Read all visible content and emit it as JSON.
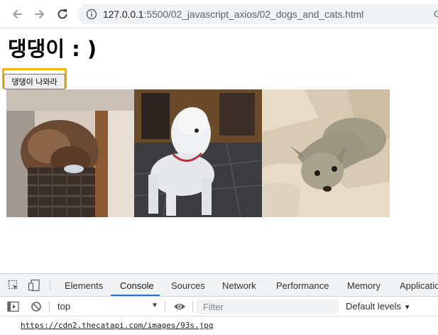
{
  "browser": {
    "url_host": "127.0.0.1",
    "url_path": ":5500/02_javascript_axios/02_dogs_and_cats.html",
    "edge_glyph": "G"
  },
  "page": {
    "title": "댕댕이 : )",
    "button_label": "댕댕이 나와라",
    "images": [
      {
        "alt": "brown curly dog sleeping in basket"
      },
      {
        "alt": "white poodle standing on tile floor"
      },
      {
        "alt": "grey whippet lying on blanket"
      }
    ]
  },
  "devtools": {
    "tabs": [
      "Elements",
      "Console",
      "Sources",
      "Network",
      "Performance",
      "Memory",
      "Applicatio"
    ],
    "active_tab": "Console",
    "context": "top",
    "filter_placeholder": "Filter",
    "levels_label": "Default levels",
    "log_message": "https://cdn2.thecatapi.com/images/93s.jpg"
  },
  "colors": {
    "focus_ring": "#f4b400",
    "active_tab_underline": "#1a73e8"
  }
}
